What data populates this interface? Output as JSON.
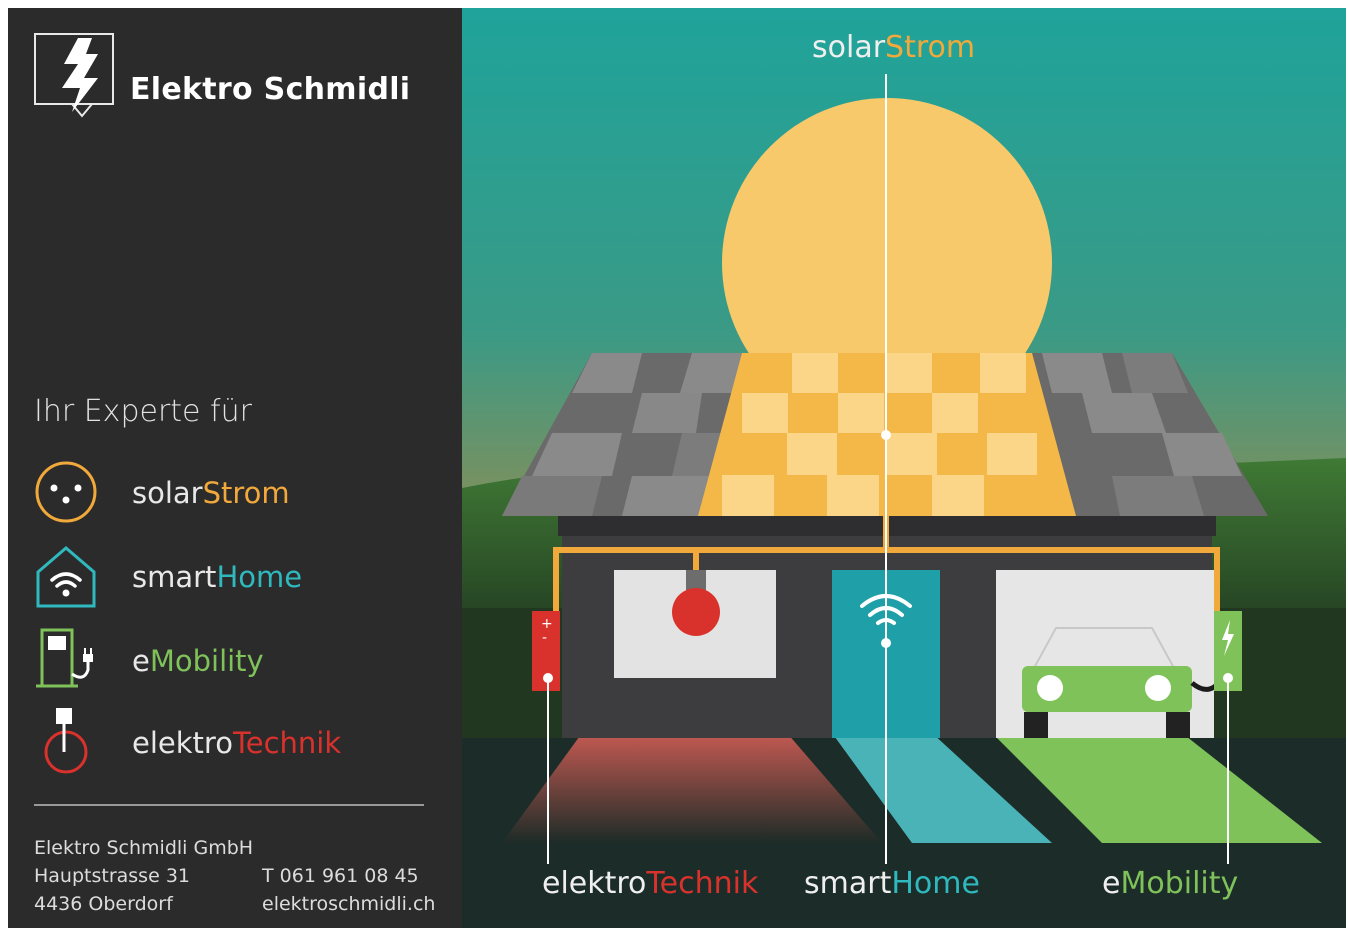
{
  "brand": {
    "name": "Elektro Schmidli"
  },
  "intro": "Ihr Experte für",
  "services": [
    {
      "prefix": "solar",
      "suffix": "Strom",
      "icon": "solar-plug-icon",
      "accent": "#f2a93b"
    },
    {
      "prefix": "smart",
      "suffix": "Home",
      "icon": "smart-home-wifi-icon",
      "accent": "#2fb8bd"
    },
    {
      "prefix": "e",
      "suffix": "Mobility",
      "icon": "charging-station-icon",
      "accent": "#7fc25a"
    },
    {
      "prefix": "elektro",
      "suffix": "Technik",
      "icon": "power-icon",
      "accent": "#d9312c"
    }
  ],
  "contact": {
    "company": "Elektro Schmidli GmbH",
    "street": "Hauptstrasse 31",
    "city": "4436 Oberdorf",
    "phone": "T  061 961 08 45",
    "web": "elektroschmidli.ch"
  },
  "illustration": {
    "top_label": {
      "prefix": "solar",
      "suffix": "Strom"
    },
    "bottom_labels": [
      {
        "prefix": "elektro",
        "suffix": "Technik"
      },
      {
        "prefix": "smart",
        "suffix": "Home"
      },
      {
        "prefix": "e",
        "suffix": "Mobility"
      }
    ]
  },
  "colors": {
    "sidebar_bg": "#2b2b2b",
    "sky_top": "#1fa39a",
    "sky_bottom": "#c58a3a",
    "sun": "#f8c96a",
    "orange": "#f2a93b",
    "teal": "#2fb8bd",
    "green": "#7fc25a",
    "red": "#d9312c"
  }
}
